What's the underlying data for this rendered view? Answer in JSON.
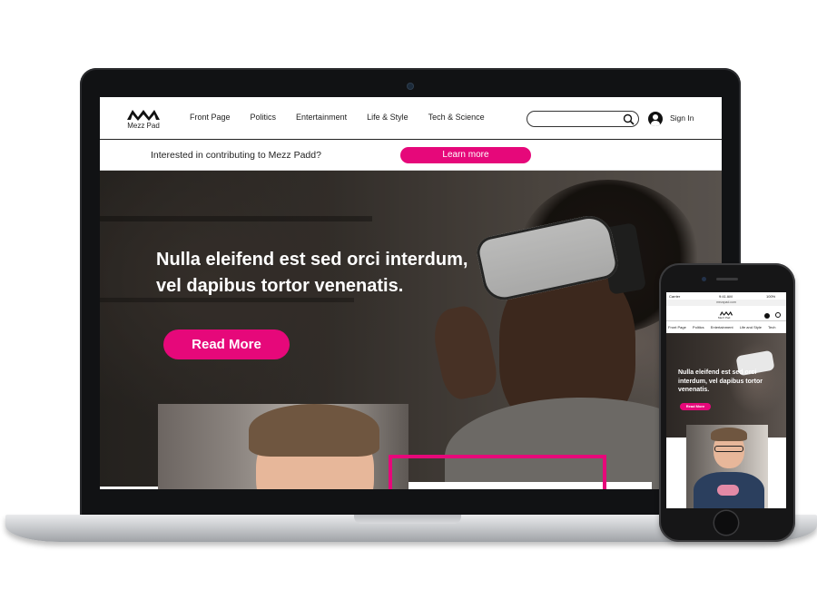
{
  "desktop": {
    "logo": {
      "text": "Mezz Pad",
      "icon": "mezz-pad-logo"
    },
    "nav": [
      "Front Page",
      "Politics",
      "Entertainment",
      "Life & Style",
      "Tech & Science"
    ],
    "search": {
      "placeholder": "",
      "icon": "search-icon"
    },
    "account": {
      "icon": "user-icon",
      "sign_in": "Sign In"
    },
    "banner": {
      "text": "Interested in contributing to Mezz Padd?",
      "button": "Learn more"
    },
    "hero": {
      "title_line1": "Nulla eleifend est sed orci interdum,",
      "title_line2": "vel dapibus tortor venenatis.",
      "button": "Read More"
    }
  },
  "mobile": {
    "status": {
      "carrier": "Carrier",
      "time": "9:41 AM",
      "battery": "100%"
    },
    "url": "mezzpad.com",
    "logo_text": "Mezz Pad",
    "nav": [
      "Front Page",
      "Politics",
      "Entertainment",
      "Life and Style",
      "Tech"
    ],
    "hero": {
      "title": "Nulla eleifend est sed orci interdum, vel dapibus tortor venenatis.",
      "button": "Read More"
    }
  },
  "colors": {
    "accent": "#e6087a",
    "header_text": "#222222",
    "hero_text": "#ffffff"
  }
}
